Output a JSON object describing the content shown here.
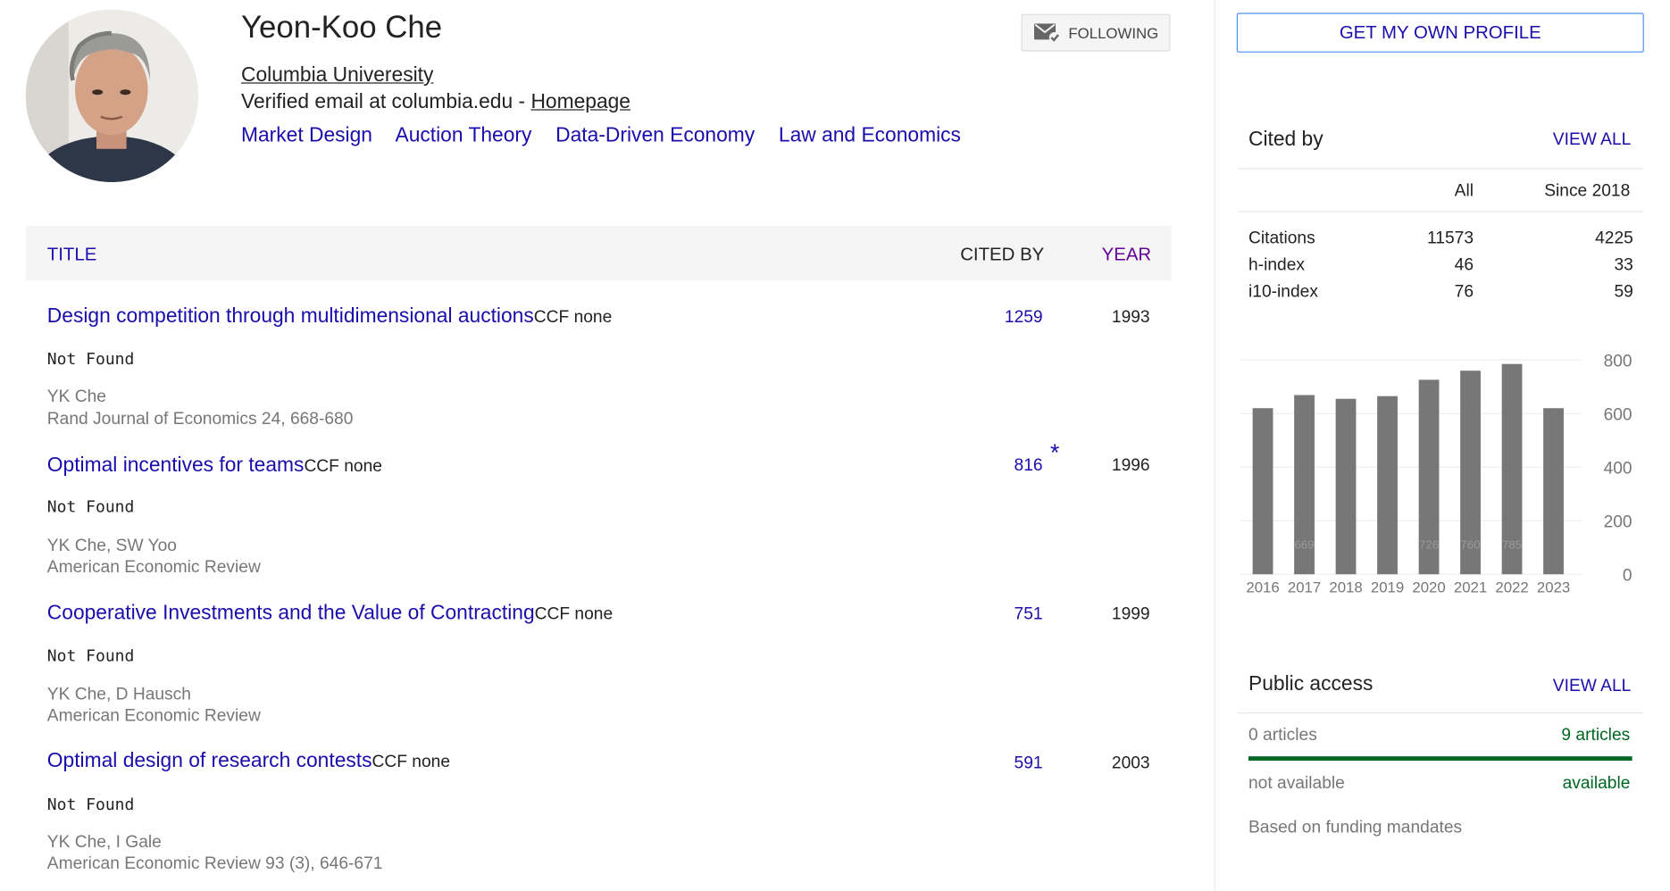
{
  "profile": {
    "name": "Yeon-Koo Che",
    "affiliation": "Columbia Univeresity",
    "email_text": "Verified email at columbia.edu - ",
    "homepage": "Homepage",
    "interests": [
      "Market Design",
      "Auction Theory",
      "Data-Driven Economy",
      "Law and Economics"
    ],
    "follow_label": "FOLLOWING"
  },
  "table": {
    "col_title": "TITLE",
    "col_cited": "CITED BY",
    "col_year": "YEAR",
    "rows": [
      {
        "title": "Design competition through multidimensional auctions",
        "ccf": "CCF none",
        "not_found": "Not Found",
        "authors": "YK Che",
        "venue": "Rand Journal of Economics 24, 668-680",
        "cited": "1259",
        "star": "",
        "year": "1993"
      },
      {
        "title": "Optimal incentives for teams",
        "ccf": "CCF none",
        "not_found": "Not Found",
        "authors": "YK Che, SW Yoo",
        "venue": "American Economic Review",
        "cited": "816",
        "star": "*",
        "year": "1996"
      },
      {
        "title": "Cooperative Investments and the Value of Contracting",
        "ccf": "CCF none",
        "not_found": "Not Found",
        "authors": "YK Che, D Hausch",
        "venue": "American Economic Review",
        "cited": "751",
        "star": "",
        "year": "1999"
      },
      {
        "title": "Optimal design of research contests",
        "ccf": "CCF none",
        "not_found": "Not Found",
        "authors": "YK Che, I Gale",
        "venue": "American Economic Review 93 (3), 646-671",
        "cited": "591",
        "star": "",
        "year": "2003"
      }
    ]
  },
  "sidebar": {
    "profile_button": "GET MY OWN PROFILE",
    "cited_by": "Cited by",
    "view_all": "VIEW ALL",
    "col_all": "All",
    "col_since": "Since 2018",
    "stats": [
      {
        "label": "Citations",
        "all": "11573",
        "since": "4225"
      },
      {
        "label": "h-index",
        "all": "46",
        "since": "33"
      },
      {
        "label": "i10-index",
        "all": "76",
        "since": "59"
      }
    ],
    "public_access": "Public access",
    "pa_view_all": "VIEW ALL",
    "pa_zero": "0 articles",
    "pa_nine": "9 articles",
    "pa_not_available": "not available",
    "pa_available": "available",
    "pa_fraction_available": 1.0,
    "pa_note": "Based on funding mandates"
  },
  "chart_data": {
    "type": "bar",
    "categories": [
      "2016",
      "2017",
      "2018",
      "2019",
      "2020",
      "2021",
      "2022",
      "2023"
    ],
    "values": [
      620,
      669,
      655,
      665,
      726,
      760,
      785,
      620
    ],
    "value_labels": [
      "",
      "669",
      "",
      "",
      "726",
      "760",
      "785",
      ""
    ],
    "yticks": [
      0,
      200,
      400,
      600,
      800
    ],
    "ylim": [
      0,
      800
    ],
    "bar_color": "#777777",
    "grid": true
  }
}
